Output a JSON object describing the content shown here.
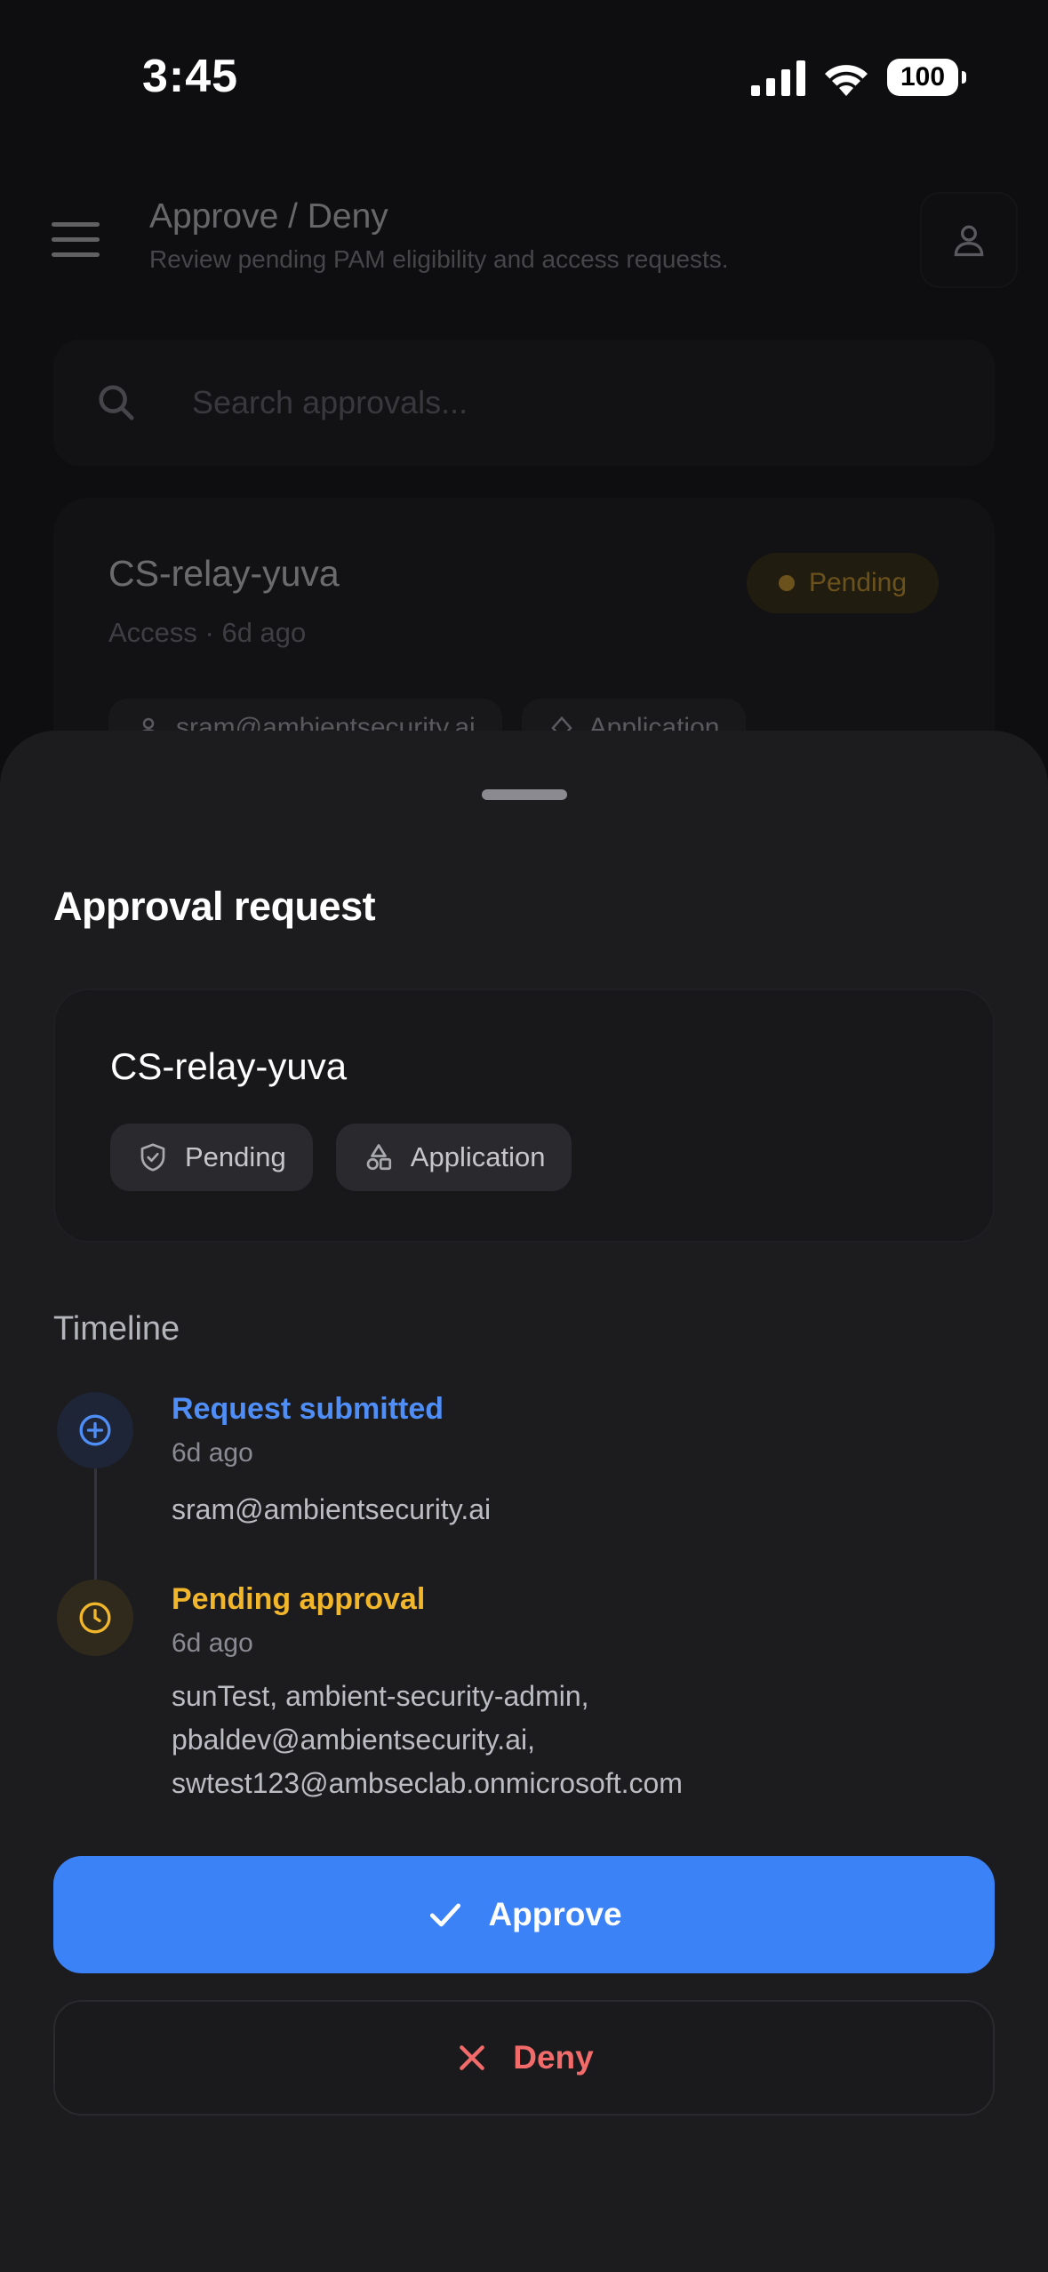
{
  "status_bar": {
    "time": "3:45",
    "battery": "100"
  },
  "header": {
    "title": "Approve / Deny",
    "subtitle": "Review pending PAM eligibility and access requests."
  },
  "search": {
    "placeholder": "Search approvals..."
  },
  "list": {
    "items": [
      {
        "title": "CS-relay-yuva",
        "meta": "Access · 6d ago",
        "status": "Pending",
        "chips": [
          "sram@ambientsecurity.ai",
          "Application"
        ]
      }
    ]
  },
  "sheet": {
    "title": "Approval request",
    "summary": {
      "title": "CS-relay-yuva",
      "status_chip": "Pending",
      "type_chip": "Application"
    },
    "timeline": {
      "heading": "Timeline",
      "events": [
        {
          "title": "Request submitted",
          "time": "6d ago",
          "detail": "sram@ambientsecurity.ai",
          "icon": "plus-circle-icon"
        },
        {
          "title": "Pending approval",
          "time": "6d ago",
          "detail_lines": [
            "sunTest, ambient-security-admin,",
            "pbaldev@ambientsecurity.ai,",
            "swtest123@ambseclab.onmicrosoft.com"
          ],
          "icon": "clock-icon"
        }
      ]
    },
    "actions": {
      "approve_label": "Approve",
      "deny_label": "Deny"
    }
  },
  "colors": {
    "accent_blue": "#3b82f6",
    "pending_amber": "#f2b62b",
    "deny_red": "#f26b6b",
    "sheet_bg": "#1c1c1f"
  }
}
